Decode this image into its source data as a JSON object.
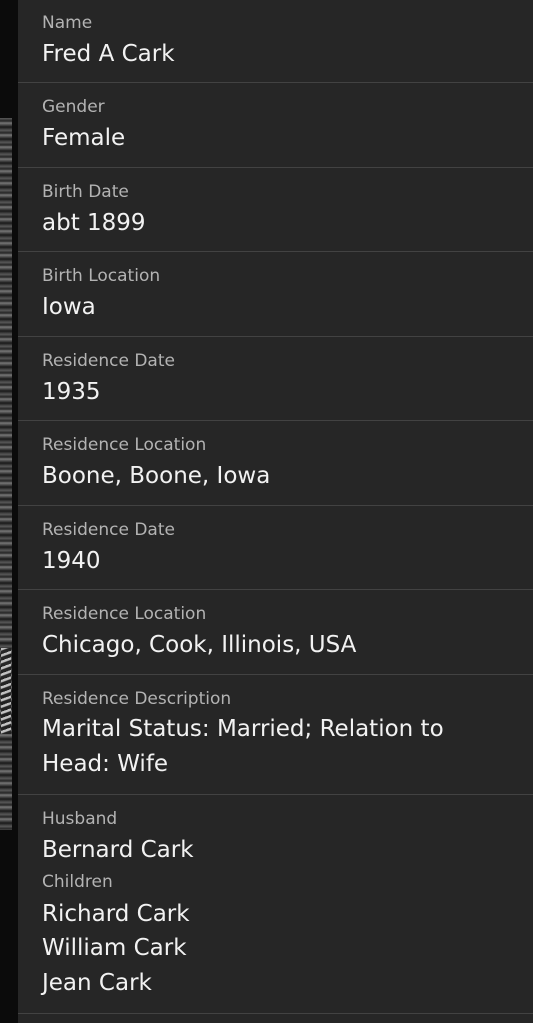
{
  "fields": [
    {
      "label": "Name",
      "value": "Fred A Cark"
    },
    {
      "label": "Gender",
      "value": "Female"
    },
    {
      "label": "Birth Date",
      "value": "abt 1899"
    },
    {
      "label": "Birth Location",
      "value": "Iowa"
    },
    {
      "label": "Residence Date",
      "value": "1935"
    },
    {
      "label": "Residence Location",
      "value": "Boone, Boone, Iowa"
    },
    {
      "label": "Residence Date",
      "value": "1940"
    },
    {
      "label": "Residence Location",
      "value": "Chicago, Cook, Illinois, USA"
    },
    {
      "label": "Residence Description",
      "value": "Marital Status: Married; Relation to Head: Wife"
    }
  ],
  "family": {
    "husband_label": "Husband",
    "husband": "Bernard Cark",
    "children_label": "Children",
    "children": [
      "Richard Cark",
      "William Cark",
      "Jean Cark"
    ]
  }
}
